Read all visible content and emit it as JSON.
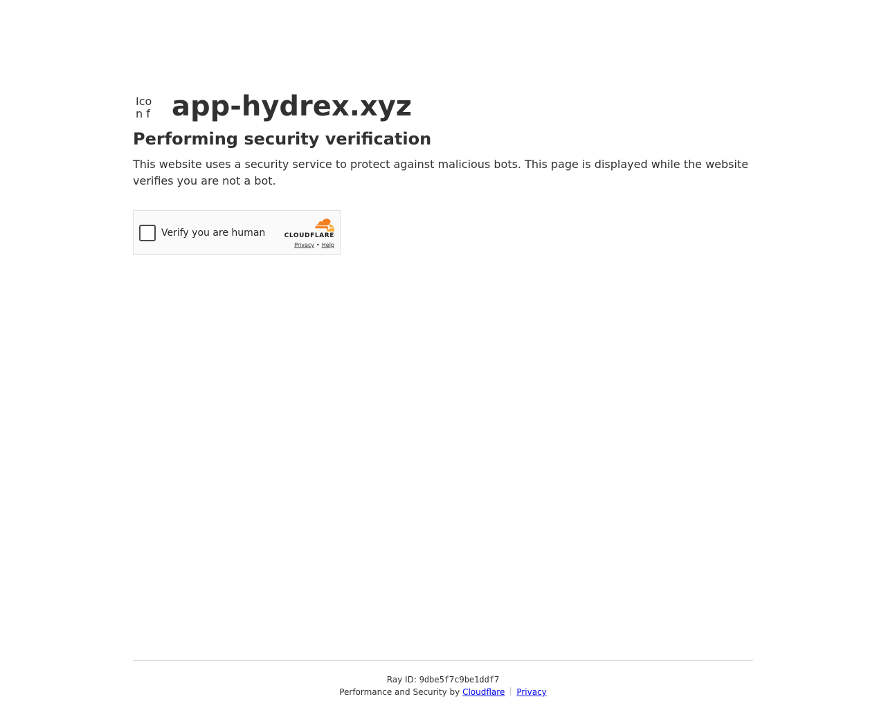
{
  "header": {
    "favicon_alt": "Icon for app-hydrex.xyz",
    "site_name": "app-hydrex.xyz"
  },
  "main": {
    "heading": "Performing security verification",
    "description": "This website uses a security service to protect against malicious bots. This page is displayed while the website verifies you are not a bot."
  },
  "widget": {
    "checkbox_label": "Verify you are human",
    "checked": false,
    "brand_name": "CLOUDFLARE",
    "privacy_link": "Privacy",
    "separator": "•",
    "help_link": "Help",
    "colors": {
      "cloud_orange": "#f38020",
      "cloud_light": "#faae40"
    }
  },
  "footer": {
    "ray_label": "Ray ID: ",
    "ray_id": "9dbe5f7c9be1ddf7",
    "perf_text": "Performance and Security by ",
    "cloudflare_link": "Cloudflare",
    "privacy_link": "Privacy"
  }
}
